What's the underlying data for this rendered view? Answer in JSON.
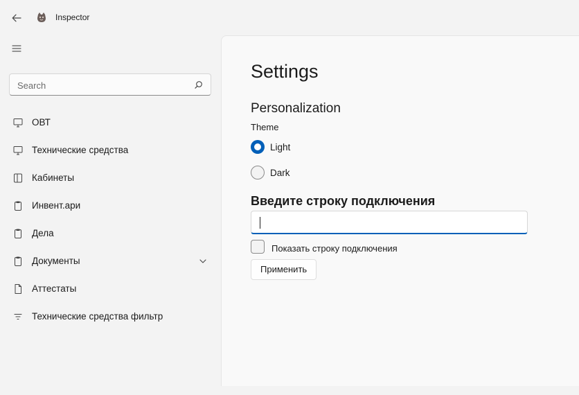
{
  "titlebar": {
    "app_title": "Inspector"
  },
  "search": {
    "placeholder": "Search"
  },
  "nav": {
    "items": [
      {
        "label": "ОВТ",
        "icon": "monitor-icon"
      },
      {
        "label": "Технические средства",
        "icon": "monitor-icon"
      },
      {
        "label": "Кабинеты",
        "icon": "panel-icon"
      },
      {
        "label": "Инвент.ари",
        "icon": "clipboard-icon"
      },
      {
        "label": "Дела",
        "icon": "clipboard-icon"
      },
      {
        "label": "Документы",
        "icon": "clipboard-icon",
        "expandable": true
      },
      {
        "label": "Аттестаты",
        "icon": "document-icon"
      },
      {
        "label": "Технические средства фильтр",
        "icon": "filter-icon"
      }
    ]
  },
  "settings": {
    "title": "Settings",
    "personalization_title": "Personalization",
    "theme_label": "Theme",
    "theme_options": [
      {
        "label": "Light",
        "selected": true
      },
      {
        "label": "Dark",
        "selected": false
      }
    ],
    "connection_title": "Введите строку подключения",
    "connection_value": "",
    "show_connection_label": "Показать строку подключения",
    "show_connection_checked": false,
    "apply_label": "Применить"
  },
  "colors": {
    "accent": "#005fb8",
    "background": "#f3f3f3",
    "content": "#f9f9f9"
  }
}
